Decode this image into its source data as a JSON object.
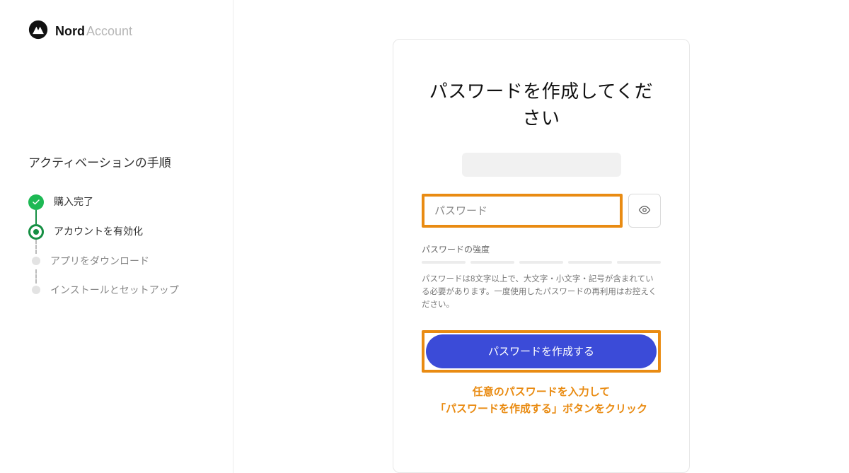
{
  "brand": {
    "bold": "Nord",
    "light": "Account"
  },
  "sidebar": {
    "title": "アクティベーションの手順",
    "steps": {
      "s0": {
        "label": "購入完了"
      },
      "s1": {
        "label": "アカウントを有効化"
      },
      "s2": {
        "label": "アプリをダウンロード"
      },
      "s3": {
        "label": "インストールとセットアップ"
      }
    }
  },
  "card": {
    "heading": "パスワードを作成してください",
    "password_placeholder": "パスワード",
    "strength_label": "パスワードの強度",
    "helper": "パスワードは8文字以上で、大文字・小文字・記号が含まれている必要があります。一度使用したパスワードの再利用はお控えください。",
    "button": "パスワードを作成する"
  },
  "annotation": {
    "line1": "任意のパスワードを入力して",
    "line2": "「パスワードを作成する」ボタンをクリック"
  }
}
